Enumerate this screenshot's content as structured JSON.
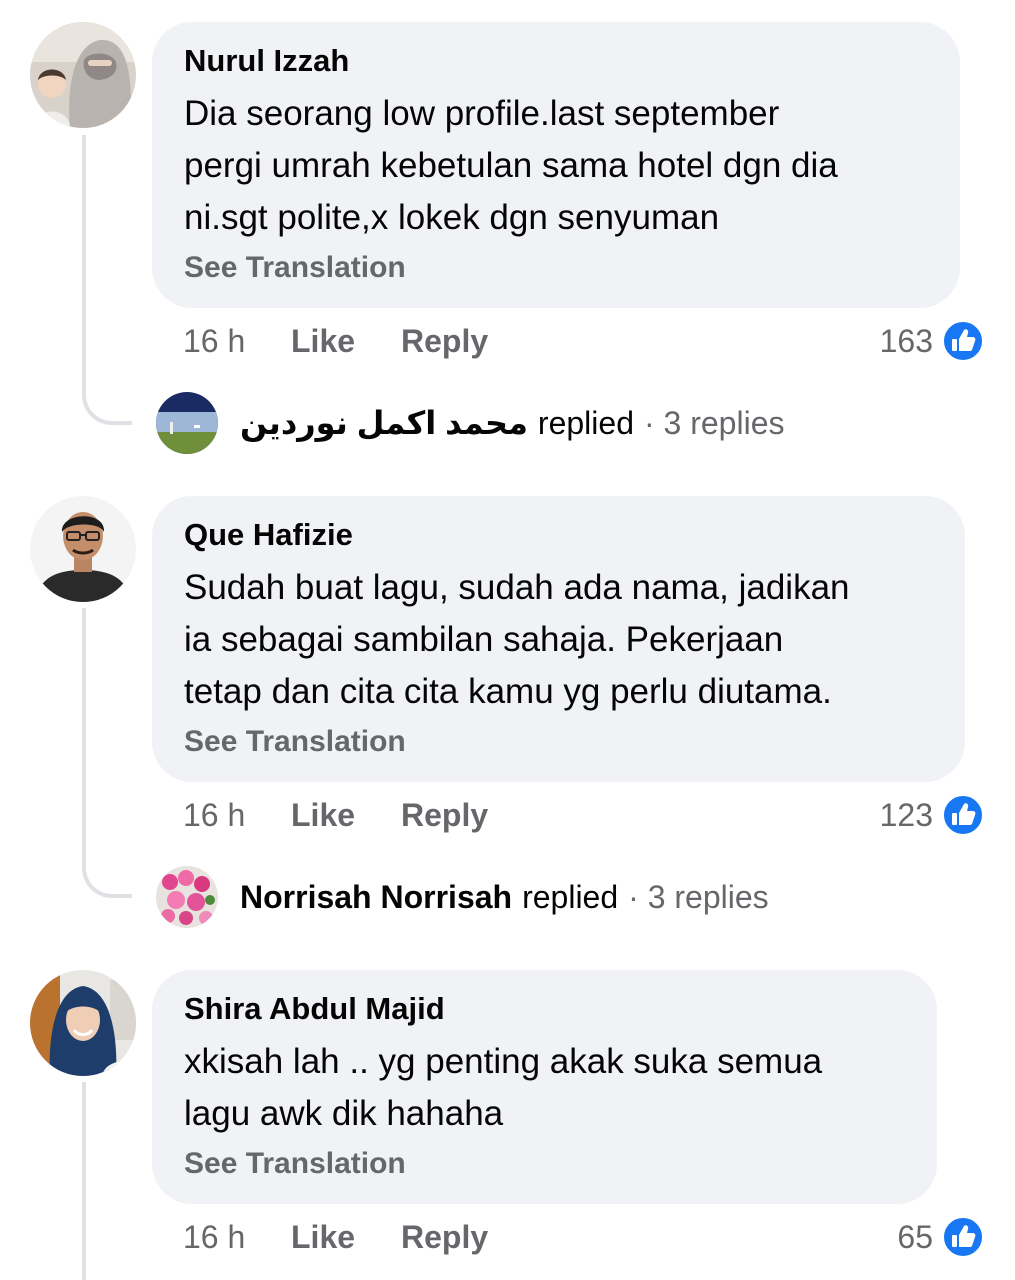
{
  "comments": [
    {
      "author": "Nurul Izzah",
      "avatar": "avatar-niqab-woman-with-child",
      "lines": [
        "Dia seorang low profile.last september",
        "pergi umrah kebetulan sama hotel dgn dia",
        "ni.sgt polite,x lokek dgn senyuman"
      ],
      "see_translation": "See Translation",
      "time": "16 h",
      "like": "Like",
      "reply": "Reply",
      "reaction_count": "163",
      "reply_summary": {
        "replier": "محمد اكمل نوردين",
        "replied": "replied",
        "count": "· 3 replies",
        "avatar": "avatar-landscape"
      }
    },
    {
      "author": "Que Hafizie",
      "avatar": "avatar-man-glasses",
      "lines": [
        "Sudah buat lagu, sudah ada nama, jadikan",
        "ia sebagai sambilan sahaja. Pekerjaan",
        "tetap dan cita cita kamu yg perlu diutama."
      ],
      "see_translation": "See Translation",
      "time": "16 h",
      "like": "Like",
      "reply": "Reply",
      "reaction_count": "123",
      "reply_summary": {
        "replier": "Norrisah Norrisah",
        "replied": "replied",
        "count": "· 3 replies",
        "avatar": "avatar-pink-flowers"
      }
    },
    {
      "author": "Shira Abdul Majid",
      "avatar": "avatar-woman-hijab",
      "lines": [
        "xkisah lah .. yg penting akak suka semua",
        "lagu awk dik hahaha"
      ],
      "see_translation": "See Translation",
      "time": "16 h",
      "like": "Like",
      "reply": "Reply",
      "reaction_count": "65"
    }
  ],
  "colors": {
    "bubble": "#f0f2f5",
    "muted_text": "#65676b",
    "like_blue": "#1877f2",
    "thread_line": "#dfe1e5"
  }
}
